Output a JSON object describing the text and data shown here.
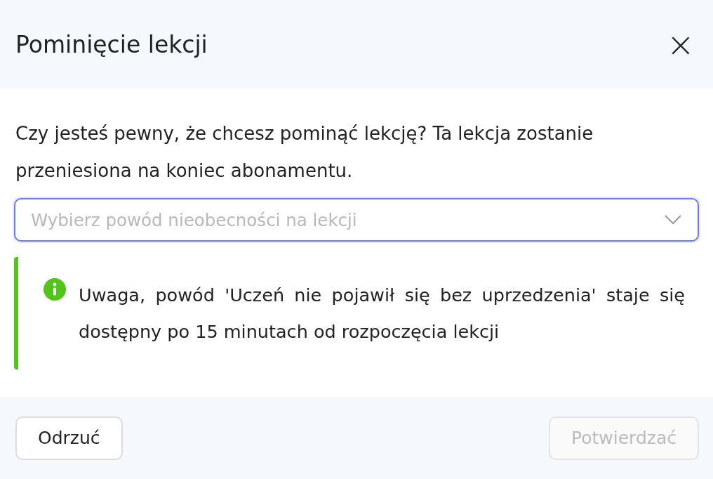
{
  "dialog": {
    "title": "Pominięcie lekcji",
    "close_label": "×"
  },
  "message": "Czy jesteś pewny, że chcesz pominąć lekcję? Ta lekcja zostanie przeniesiona na koniec abonamentu.",
  "reason_select": {
    "placeholder": "Wybierz powód nieobecności na lekcji"
  },
  "notice": {
    "kind": "info",
    "text": "Uwaga, powód 'Uczeń nie pojawił się bez uprzedzenia' staje się dostępny po 15 minutach od rozpoczęcia lekcji"
  },
  "buttons": [
    {
      "label": "Odrzuć",
      "disabled": false
    },
    {
      "label": "Potwierdzać",
      "disabled": true
    }
  ]
}
